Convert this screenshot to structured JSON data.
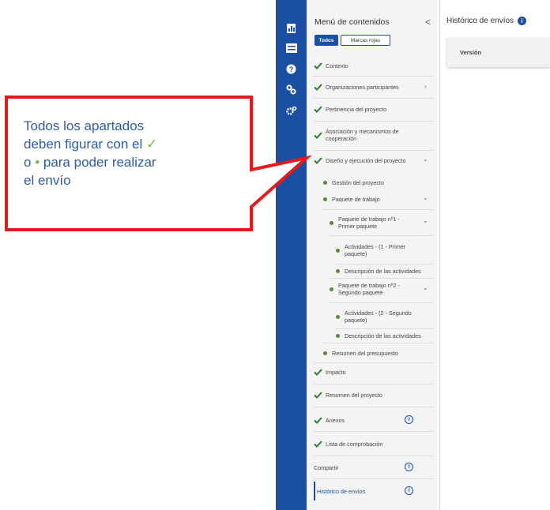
{
  "sidebar_icons": [
    "chart-icon",
    "list-icon",
    "help-icon",
    "link-icon",
    "settings-icon"
  ],
  "panel": {
    "title": "Menú de contenidos",
    "collapse": "<",
    "filters": {
      "all": "Todos",
      "red": "Marcas rojas"
    }
  },
  "menu": {
    "contexto": "Contexto",
    "organizaciones": "Organizaciones participantes",
    "pertinencia": "Pertinencia del proyecto",
    "asociacion": "Asociación y mecanismos de cooperación",
    "diseno": "Diseño y ejecución del proyecto",
    "gestion": "Gestión del proyecto",
    "paquete": "Paquete de trabajo",
    "paquete1": "Paquete de trabajo nº1 - Primer paquete",
    "actividades1": "Actividades - (1 - Primer paquete)",
    "descripcion1": "Descripción de las actividades",
    "paquete2": "Paquete de trabajo nº2 - Segundo paquete",
    "actividades2": "Actividades - (2 - Segundo paquete)",
    "descripcion2": "Descripción de las actividades",
    "resumen_presupuesto": "Resumen del presupuesto",
    "impacto": "Impacto",
    "resumen_proyecto": "Resumen del proyecto",
    "anexos": "Anexos",
    "anexos_count": "0",
    "lista": "Lista de comprobación",
    "compartir": "Compartir",
    "compartir_count": "0",
    "historico": "Histórico de envíos",
    "historico_count": "0"
  },
  "history": {
    "title": "Histórico de envíos",
    "info": "i",
    "version_label": "Versión"
  },
  "callout": {
    "line1": "Todos los apartados",
    "line2a": "deben figurar con el ",
    "check": "✓",
    "line3a": "o ",
    "dot": "•",
    "line3b": " para poder realizar",
    "line4": "el envío"
  },
  "colors": {
    "rail": "#1b4fa3",
    "check": "#2e7d32",
    "dot": "#5c8a2e",
    "callout_border": "#e8191c"
  }
}
